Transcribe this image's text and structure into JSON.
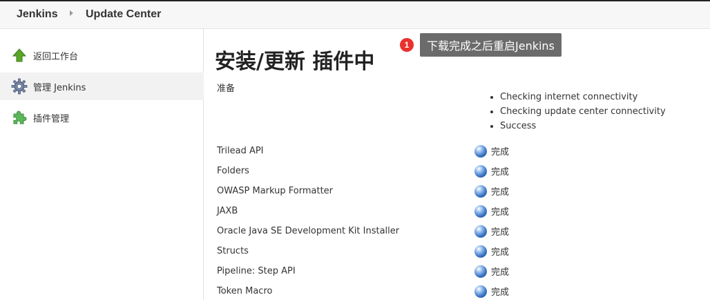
{
  "breadcrumb": {
    "home": "Jenkins",
    "current": "Update Center"
  },
  "sidebar": {
    "items": [
      {
        "label": "返回工作台",
        "icon": "up-arrow-icon"
      },
      {
        "label": "管理 Jenkins",
        "icon": "gear-icon"
      },
      {
        "label": "插件管理",
        "icon": "puzzle-icon"
      }
    ]
  },
  "main": {
    "title": "安装/更新 插件中",
    "prep_label": "准备",
    "checks": [
      "Checking internet connectivity",
      "Checking update center connectivity",
      "Success"
    ],
    "plugins": [
      {
        "name": "Trilead API",
        "status": "完成"
      },
      {
        "name": "Folders",
        "status": "完成"
      },
      {
        "name": "OWASP Markup Formatter",
        "status": "完成"
      },
      {
        "name": "JAXB",
        "status": "完成"
      },
      {
        "name": "Oracle Java SE Development Kit Installer",
        "status": "完成"
      },
      {
        "name": "Structs",
        "status": "完成"
      },
      {
        "name": "Pipeline: Step API",
        "status": "完成"
      },
      {
        "name": "Token Macro",
        "status": "完成"
      }
    ]
  },
  "annotation": {
    "badge": "1",
    "text": "下载完成之后重启Jenkins"
  }
}
